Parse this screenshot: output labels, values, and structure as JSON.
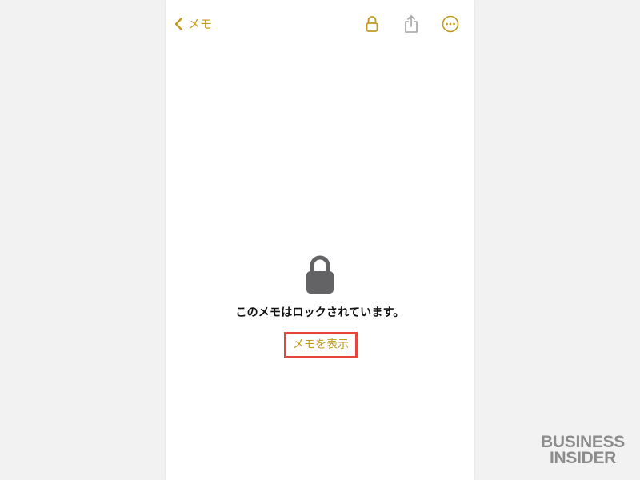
{
  "colors": {
    "accent": "#c29a1f",
    "disabled_icon": "#a3a3a3",
    "lock_gray": "#636366",
    "highlight_red": "#e6453b",
    "watermark_gray": "#8c8c8c"
  },
  "nav": {
    "back_label": "メモ",
    "icons": [
      "chevron-left-icon",
      "lock-icon",
      "share-icon",
      "more-icon"
    ]
  },
  "locked_view": {
    "message": "このメモはロックされています。",
    "show_note_label": "メモを表示"
  },
  "watermark": {
    "line1": "BUSINESS",
    "line2": "INSIDER"
  }
}
